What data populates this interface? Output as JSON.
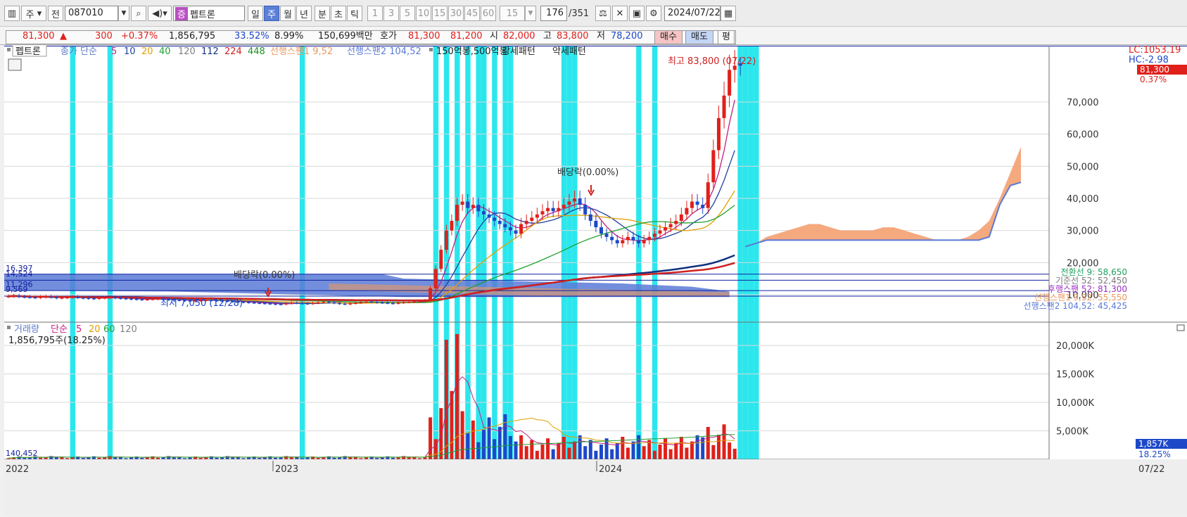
{
  "toolbar": {
    "mode": "주",
    "prev": "전",
    "code": "087010",
    "stock_tag": "증",
    "stock_name": "펩트론",
    "periods": [
      "일",
      "주",
      "월",
      "년"
    ],
    "selected_period": "주",
    "intraday": [
      "분",
      "초",
      "틱"
    ],
    "intervals": [
      "1",
      "3",
      "5",
      "10",
      "15",
      "30",
      "45",
      "60"
    ],
    "interval_value": "15",
    "count": "176",
    "total": "/351",
    "date": "2024/07/22"
  },
  "quote": {
    "price": "81,300",
    "change": "300",
    "change_pct": "+0.37%",
    "volume": "1,856,795",
    "turnover_pct": "33.52%",
    "ratio_pct": "8.99%",
    "amount": "150,699백만",
    "hoga_label": "호가",
    "ask": "81,300",
    "bid": "81,200",
    "open_label": "시",
    "open": "82,000",
    "high_label": "고",
    "high": "83,800",
    "low_label": "저",
    "low": "78,200",
    "buy": "매수",
    "sell": "매도",
    "avg": "평",
    "colors": {
      "up": "#e0201a",
      "down": "#1d48c8"
    }
  },
  "legend": {
    "name": "펩트론",
    "ma_prefix": "종가 단순",
    "ma": [
      "5",
      "10",
      "20",
      "40",
      "120",
      "112",
      "224",
      "448"
    ],
    "ma_colors": [
      "#c02080",
      "#2040a0",
      "#e0a000",
      "#20a030",
      "#808080",
      "#103080",
      "#d02020",
      "#209020"
    ],
    "span1": "선행스팬1 9,52",
    "span2": "선행스팬2 104,52",
    "pattern1": "150억봉,500억봉",
    "pattern2": "강세패턴",
    "pattern3": "약세패턴"
  },
  "annotations": {
    "high_note": "최고 83,800 (07/22)",
    "div1": "배당락(0.00%)",
    "div2": "배당락(0.00%)",
    "low_note": "최저 7,050 (12/28)",
    "left_labels": [
      "16,397",
      "14,524",
      "11,296",
      "9,569"
    ]
  },
  "right_axis": {
    "lc": "LC:1053.19",
    "hc": "HC:-2.98",
    "price_tag": "81,300",
    "pct_tag": "0.37%",
    "ticks": [
      "70,000",
      "60,000",
      "50,000",
      "40,000",
      "30,000",
      "20,000",
      "10,000"
    ],
    "ichimoku": [
      {
        "text": "전환선 9: 58,650",
        "color": "#20a060"
      },
      {
        "text": "기준선 52: 52,450",
        "color": "#7a7a7a"
      },
      {
        "text": "후행스팬 52: 81,300",
        "color": "#9a30c0"
      },
      {
        "text": "선행스팬1 9,52: 55,550",
        "color": "#e89860"
      },
      {
        "text": "선행스팬2 104,52: 45,425",
        "color": "#5a7ad6"
      }
    ]
  },
  "volume_panel": {
    "title": "거래량",
    "ma_prefix": "단순",
    "ma": [
      "5",
      "20",
      "60",
      "120"
    ],
    "ma_colors": [
      "#c02080",
      "#e0a000",
      "#20a030",
      "#808080"
    ],
    "current": "1,856,795주(18.25%)",
    "ticks": [
      "20,000K",
      "15,000K",
      "10,000K",
      "5,000K"
    ],
    "min_label": "140,452",
    "vol_tag": "1,857K",
    "pct_tag": "18.25%"
  },
  "x_axis": {
    "labels": [
      "2022",
      "2023",
      "2024"
    ],
    "end_label": "07/22"
  },
  "chart_data": {
    "type": "candlestick",
    "title": "펩트론",
    "interval": "weekly",
    "y_price_ticks": [
      10000,
      20000,
      30000,
      40000,
      50000,
      60000,
      70000
    ],
    "y_volume_ticks_k": [
      5000,
      10000,
      15000,
      20000
    ],
    "last": {
      "date": "2024/07/22",
      "open": 82000,
      "high": 83800,
      "low": 78200,
      "close": 81300,
      "volume": 1856795
    },
    "period_high": {
      "value": 83800,
      "date": "07/22"
    },
    "period_low": {
      "value": 7050,
      "date": "12/28"
    },
    "weekly_close_approx": [
      9500,
      9700,
      9400,
      9300,
      9200,
      9100,
      9300,
      9400,
      9200,
      9000,
      9100,
      9200,
      9300,
      9100,
      9000,
      8900,
      8800,
      9000,
      9100,
      9200,
      9000,
      8900,
      8800,
      8700,
      8600,
      8500,
      8600,
      8700,
      8800,
      8600,
      8500,
      8400,
      8300,
      8200,
      8100,
      8200,
      8300,
      8400,
      8300,
      8200,
      8100,
      8000,
      7900,
      7800,
      7700,
      7600,
      7500,
      7400,
      7300,
      7200,
      7100,
      7050,
      7300,
      7500,
      7400,
      7300,
      7200,
      7400,
      7600,
      7800,
      7600,
      7400,
      7200,
      7100,
      7300,
      7500,
      7700,
      7900,
      7800,
      7600,
      7500,
      7400,
      7300,
      7500,
      7700,
      7800,
      7900,
      8000,
      8200,
      12000,
      18000,
      24000,
      30000,
      33000,
      38000,
      39000,
      37000,
      38000,
      36000,
      35000,
      34000,
      33000,
      32000,
      31000,
      30000,
      29000,
      32000,
      33000,
      34000,
      35000,
      36000,
      37000,
      36000,
      37000,
      38000,
      39000,
      40000,
      38000,
      35000,
      33000,
      31000,
      29000,
      28000,
      27000,
      26000,
      27000,
      28000,
      27000,
      26000,
      27000,
      28000,
      29000,
      30000,
      31000,
      32000,
      33000,
      35000,
      37000,
      39000,
      38000,
      37000,
      45000,
      55000,
      65000,
      72000,
      80000,
      81300
    ],
    "span1_future": [
      25000,
      26000,
      28000,
      29000,
      30000,
      31000,
      32000,
      32000,
      31000,
      30000,
      30000,
      30000,
      30000,
      31000,
      31000,
      30000,
      29000,
      28000,
      27000,
      27000,
      27000,
      28000,
      30000,
      33000,
      40000,
      48000,
      56000
    ],
    "span2_future": [
      25000,
      26000,
      27000,
      27000,
      27000,
      27000,
      27000,
      27000,
      27000,
      27000,
      27000,
      27000,
      27000,
      27000,
      27000,
      27000,
      27000,
      27000,
      27000,
      27000,
      27000,
      27000,
      27000,
      28000,
      38000,
      44000,
      45000
    ],
    "ichimoku": {
      "conversion_9": 58650,
      "base_52": 52450,
      "lagging_52": 81300,
      "lead1_9_52": 55550,
      "lead2_104_52": 45425
    },
    "pattern_weeks": [
      12,
      19,
      55,
      80,
      82,
      84,
      86,
      88,
      89,
      91,
      93,
      94,
      104,
      105,
      106,
      118,
      121,
      137,
      138,
      139,
      140
    ]
  }
}
